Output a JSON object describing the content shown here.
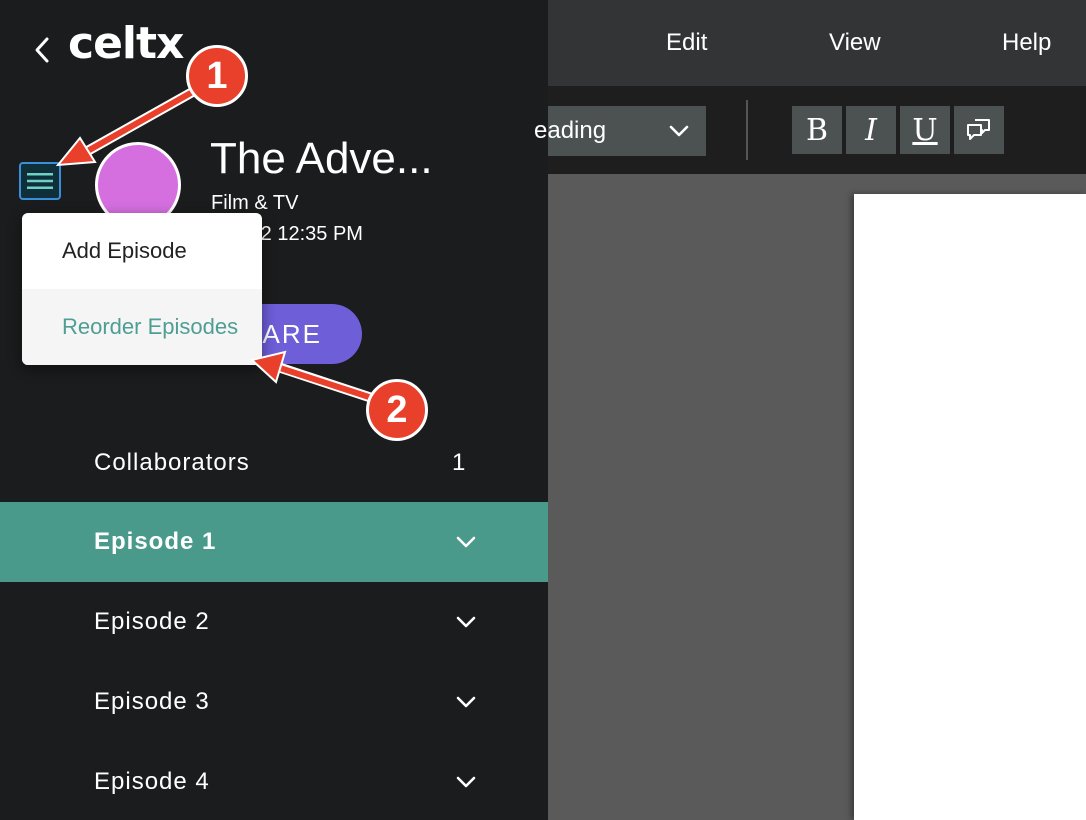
{
  "app": {
    "logo_text": "celtx",
    "project": {
      "title": "The Adve...",
      "type": "Film & TV",
      "date": "10 | 22 12:35 PM",
      "share_label": "ARE"
    },
    "project_menu": {
      "items": [
        {
          "label": "Add Episode"
        },
        {
          "label": "Reorder Episodes"
        }
      ]
    },
    "sidebar": {
      "collaborators": {
        "label": "Collaborators",
        "count": "1"
      },
      "episodes": [
        {
          "label": "Episode 1",
          "active": true
        },
        {
          "label": "Episode 2",
          "active": false
        },
        {
          "label": "Episode 3",
          "active": false
        },
        {
          "label": "Episode 4",
          "active": false
        }
      ]
    }
  },
  "menubar": {
    "items": [
      {
        "label": "Edit"
      },
      {
        "label": "View"
      },
      {
        "label": "Help"
      }
    ]
  },
  "toolbar": {
    "style_value": "eading",
    "format_buttons": [
      {
        "label": "B",
        "icon": "bold-icon"
      },
      {
        "label": "I",
        "icon": "italic-icon"
      },
      {
        "label": "U",
        "icon": "underline-icon"
      },
      {
        "icon": "comment-icon"
      }
    ]
  },
  "annotations": {
    "step1": "1",
    "step2": "2"
  },
  "colors": {
    "sidebar_bg": "#1b1c1d",
    "active_item": "#4a9a8c",
    "share_button": "#6e5ed8",
    "avatar": "#d56fe0",
    "accent_text": "#4f9e95",
    "annotation": "#e8402b"
  }
}
